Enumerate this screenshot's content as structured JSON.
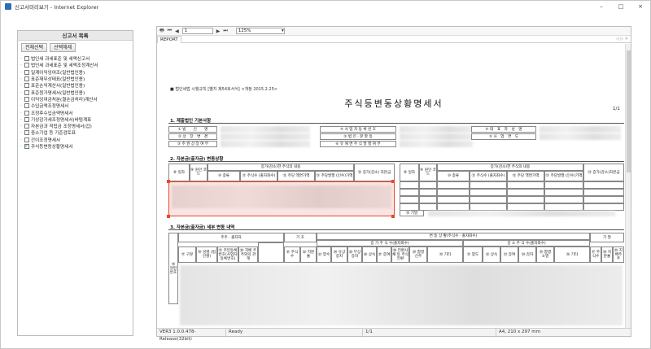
{
  "window": {
    "title": "신고서미리보기 - Internet Explorer",
    "controls": [
      "–",
      "□",
      "×"
    ]
  },
  "sidebar": {
    "header": "신고서 목록",
    "select_all_label": "전체선택",
    "deselect_all_label": "선택해제",
    "items": [
      {
        "label": "법인세 과세표준 및 세액신고서",
        "checked": false
      },
      {
        "label": "법인세 과세표준 및 세액조정계산서",
        "checked": false
      },
      {
        "label": "일계이익잉여조(일반법인용)",
        "checked": false
      },
      {
        "label": "표준재무상태표(일반법인용)",
        "checked": false
      },
      {
        "label": "표준손익계산서(일반법인용)",
        "checked": false
      },
      {
        "label": "표준원가명세서(일반법인용)",
        "checked": false
      },
      {
        "label": "이익잉여금처분(결손금처리)계산서",
        "checked": false
      },
      {
        "label": "수입금액조정명세서",
        "checked": false
      },
      {
        "label": "조정후수입금액명세서",
        "checked": false
      },
      {
        "label": "기상감가세조정명세서(바텀계표",
        "checked": false
      },
      {
        "label": "자본금과 적립금 조정명세서(갑)",
        "checked": false
      },
      {
        "label": "중소기업 등 기준검토표",
        "checked": false
      },
      {
        "label": "간이조정명세서",
        "checked": false
      },
      {
        "label": "주식등변동상황명세서",
        "checked": true
      }
    ]
  },
  "viewer": {
    "page_input": "1",
    "zoom": "125%",
    "tab_label": "REPORT",
    "tab_icons": "◁ ▷ ✕"
  },
  "document": {
    "ref_note": "■ 법인세법 시행규칙 [별지 제54호서식] <개정 2015.2.25>",
    "title": "주식등변동상황명세서",
    "page": "1/1",
    "section1": "1. 제출법인 기본사항",
    "s1_labels_left": [
      "① 법　　인　　명",
      "② 상　장　변　경",
      "③ 주 권 상 장 여 부"
    ],
    "s1_labels_mid": [
      "④ 사 업 자 등 록 번 호",
      "⑤ 법 인 · 분 할 등",
      "⑥ 유 예 면 주 식 발 행 여 부"
    ],
    "s1_labels_right": [
      "④ 대　표　자　성　명",
      "⑤ 사　업　연　도"
    ],
    "section2": "2. 자본금(출자금) 변동상황",
    "s2_headers_left": [
      "⑧ 일자",
      "⑨ 원인 코드",
      "증가(감소)한 주식의 내용",
      "⑩ 종류",
      "⑪ 주식수 (출자좌수)",
      "⑫ 주당 액면가액",
      "⑬ 주당발행 (인수)가액",
      "⑭ 증가(감소) 자본금"
    ],
    "s2_headers_right": [
      "⑧ 일자",
      "⑨ 원인 코드",
      "증가(감소)한 주식의 내용",
      "⑩ 종류",
      "⑪ 주식수 (출자좌수)",
      "⑫ 주당 액면가액",
      "⑬ 주당발행 (인수)가액",
      "⑭ 증가(감소)자본금"
    ],
    "s2_extra": "⑮ 기말",
    "section3": "3. 자본금(출자금) 세부 변동 내역",
    "s3_top": [
      "주주 · 출자자",
      "기 초",
      "변 동 상 황(주식수 · 출자좌수)",
      "기 말"
    ],
    "s3_inc": "증 가 주 식 수(출자좌수)",
    "s3_dec": "감 소 주 식 수(출자좌수)",
    "s3_cols": [
      "⑰ 구분",
      "⑱ 성명 (법인명)",
      "⑲ 주민등록 번호(사업자 등록번호)",
      "⑳ 지배 주주와의 관계",
      "㉑ 주식수",
      "㉒ 지분율",
      "㉓ 양수",
      "㉔ 유상증자",
      "㉕ 무상증자",
      "㉖ 상속",
      "㉗ 증여",
      "㉘ 전환사채 등 주식전환",
      "㉙ 합병 신주",
      "㉚ 기타",
      "㉛ 양도",
      "㉜ 상속",
      "㉝ 증여",
      "㉞ 감자",
      "㉟ 합병 소멸",
      "㊱ 기타",
      "㊲ 주식수",
      "㊳ 지분율",
      "㊴ 지배주주"
    ],
    "s3_rowlabel": "⑯ 일련번호"
  },
  "status": {
    "version": "VER3 1.0.0.478-Release(32bit)",
    "state": "Ready",
    "page": "1/1",
    "paper": "A4, 210 x 297 mm"
  }
}
